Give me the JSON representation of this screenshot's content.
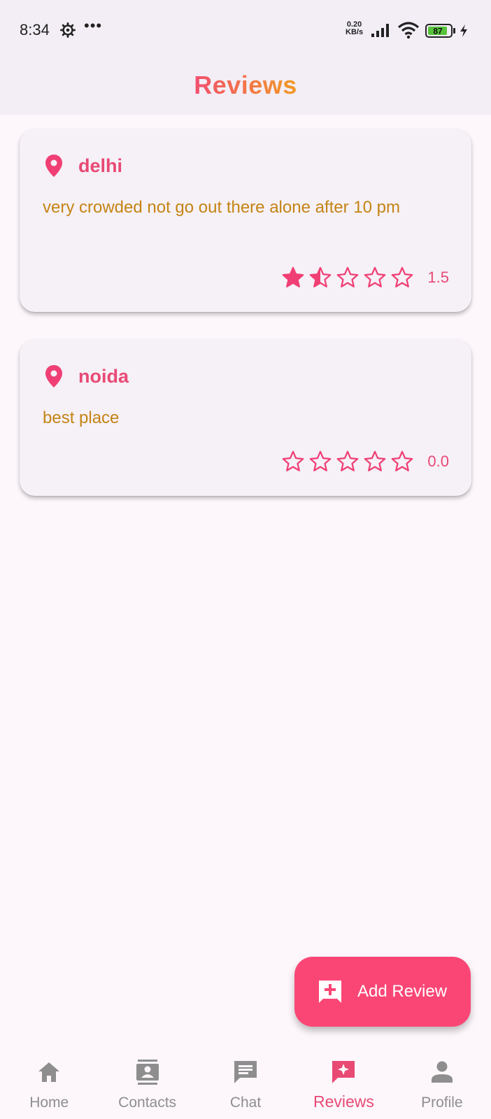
{
  "status_bar": {
    "time": "8:34",
    "dots": "•••",
    "net_speed_value": "0.20",
    "net_speed_unit": "KB/s",
    "battery": "87"
  },
  "appbar": {
    "title": "Reviews"
  },
  "reviews": [
    {
      "city": "delhi",
      "comment": "very crowded not go out there alone after 10 pm",
      "rating": "1.5",
      "stars": [
        "full",
        "half",
        "empty",
        "empty",
        "empty"
      ]
    },
    {
      "city": "noida",
      "comment": "best place",
      "rating": "0.0",
      "stars": [
        "empty",
        "empty",
        "empty",
        "empty",
        "empty"
      ]
    }
  ],
  "fab": {
    "label": "Add Review",
    "icon": "add-comment-icon"
  },
  "nav": {
    "items": [
      {
        "label": "Home",
        "icon": "home-icon"
      },
      {
        "label": "Contacts",
        "icon": "contacts-icon"
      },
      {
        "label": "Chat",
        "icon": "chat-icon"
      },
      {
        "label": "Reviews",
        "icon": "reviews-icon"
      },
      {
        "label": "Profile",
        "icon": "profile-icon"
      }
    ],
    "active": "Reviews"
  },
  "colors": {
    "accent": "#e84a74",
    "fab": "#fa4675",
    "comment": "#c48414",
    "inactive": "#8e8e8e"
  }
}
